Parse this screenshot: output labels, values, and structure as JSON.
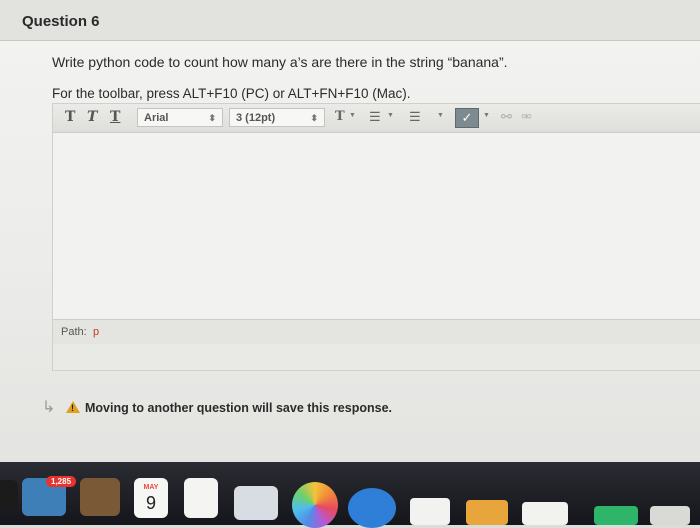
{
  "question": {
    "title": "Question 6",
    "prompt": "Write python code to count how many a’s are there in the string “banana”.",
    "toolbar_hint": "For the toolbar, press ALT+F10 (PC) or ALT+FN+F10 (Mac)."
  },
  "toolbar": {
    "font_family": "Arial",
    "font_size": "3 (12pt)",
    "text_style_buttons": [
      "T",
      "T",
      "T"
    ],
    "icons": [
      "text-color-icon",
      "bullet-list-icon",
      "numbered-list-icon",
      "spellcheck-icon",
      "link-icon",
      "unlink-icon"
    ]
  },
  "editor": {
    "content": "",
    "path_label": "Path:",
    "path_value": "p"
  },
  "warning": {
    "message": "Moving to another question will save this response."
  },
  "dock": {
    "mail_badge": "1,285",
    "calendar_month": "MAY",
    "calendar_day": "9"
  },
  "colors": {
    "warning_icon": "#e0a020",
    "path_value": "#c0392b",
    "badge": "#e8342f"
  }
}
